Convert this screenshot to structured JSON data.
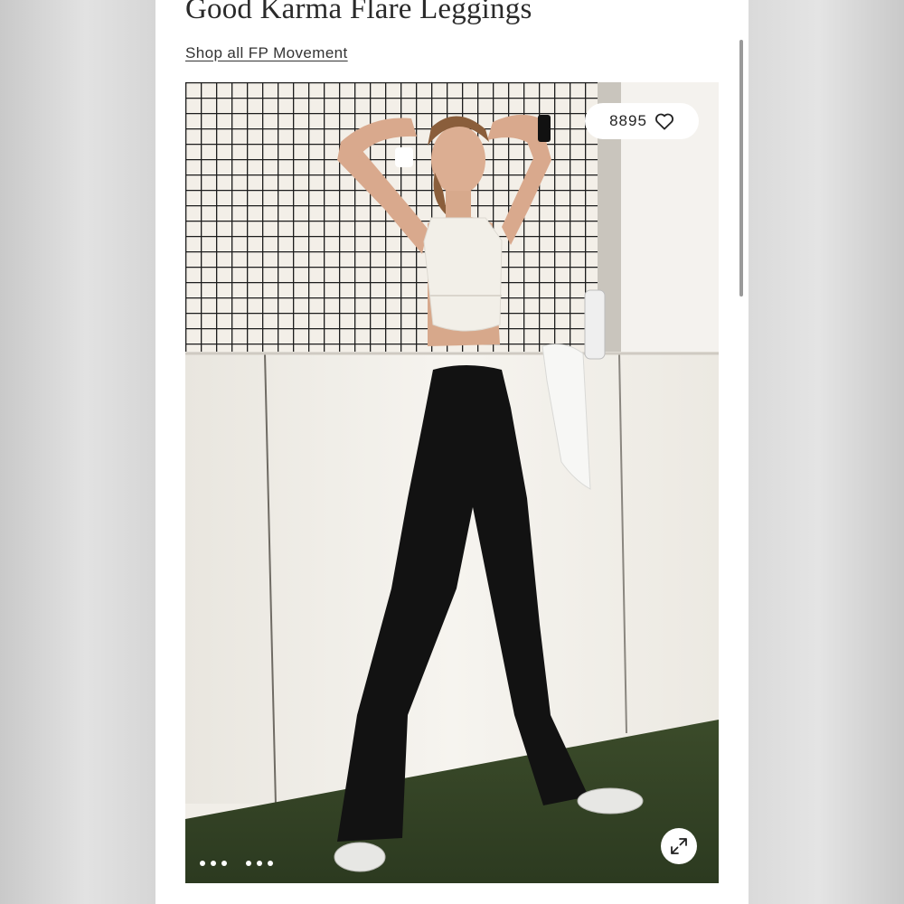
{
  "product": {
    "title": "Good Karma Flare Leggings",
    "shop_link": "Shop all FP Movement"
  },
  "gallery": {
    "like_count": "8895",
    "like_icon": "heart-outline-icon",
    "expand_icon": "expand-arrows-icon",
    "image_count": 6,
    "image_alt": "Model wearing black flare leggings and white crop top in front of a net"
  },
  "colors": {
    "text": "#2a2a2a",
    "background": "#ffffff",
    "leggings": "#121212"
  }
}
